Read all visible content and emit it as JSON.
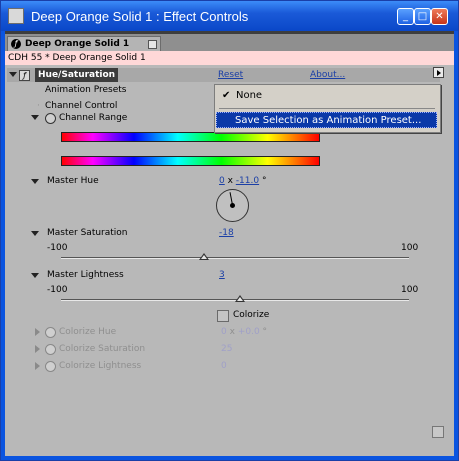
{
  "window": {
    "title": "Deep Orange Solid 1 : Effect Controls",
    "buttons": {
      "minimize": "_",
      "maximize": "□",
      "close": "✕"
    }
  },
  "tab": {
    "label": "Deep Orange Solid 1"
  },
  "breadcrumb": "CDH 55 * Deep Orange Solid 1",
  "effect": {
    "name": "Hue/Saturation",
    "reset_label": "Reset",
    "about_label": "About...",
    "animation_presets_label": "Animation Presets",
    "channel_control_label": "Channel Control",
    "channel_range_label": "Channel Range"
  },
  "master_hue": {
    "label": "Master Hue",
    "revolutions": "0",
    "x_sep": "x",
    "degrees": "-11.0",
    "deg_symbol": "°"
  },
  "master_saturation": {
    "label": "Master Saturation",
    "value": "-18",
    "min": "-100",
    "max": "100",
    "level_percent": 41
  },
  "master_lightness": {
    "label": "Master Lightness",
    "value": "3",
    "min": "-100",
    "max": "100",
    "level_percent": 51.5
  },
  "colorize": {
    "checkbox_label": "Colorize",
    "hue_label": "Colorize Hue",
    "hue_revolutions": "0",
    "hue_x": "x",
    "hue_degrees": "+0.0",
    "hue_deg_symbol": "°",
    "saturation_label": "Colorize Saturation",
    "saturation_value": "25",
    "lightness_label": "Colorize Lightness",
    "lightness_value": "0"
  },
  "presets_menu": {
    "items": [
      {
        "label": "None",
        "checked": true
      },
      {
        "label": "Save Selection as Animation Preset..."
      }
    ]
  }
}
